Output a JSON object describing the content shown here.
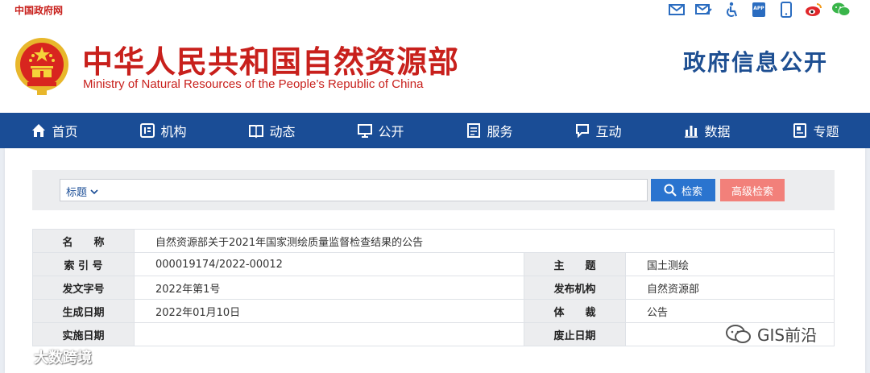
{
  "topbar": {
    "site_link": "中国政府网",
    "icons": [
      "mail-icon",
      "mail-edit-icon",
      "accessibility-icon",
      "app-icon",
      "mobile-icon",
      "weibo-icon",
      "wechat-icon"
    ],
    "app_label": "APP"
  },
  "header": {
    "title_cn": "中华人民共和国自然资源部",
    "title_en": "Ministry of Natural Resources of the People’s Republic of China",
    "gov_info": "政府信息公开"
  },
  "nav": {
    "items": [
      {
        "label": "首页",
        "icon": "home-icon"
      },
      {
        "label": "机构",
        "icon": "org-icon"
      },
      {
        "label": "动态",
        "icon": "book-icon"
      },
      {
        "label": "公开",
        "icon": "monitor-icon"
      },
      {
        "label": "服务",
        "icon": "form-icon"
      },
      {
        "label": "互动",
        "icon": "chat-icon"
      },
      {
        "label": "数据",
        "icon": "bar-chart-icon"
      },
      {
        "label": "专题",
        "icon": "topic-icon"
      }
    ]
  },
  "search": {
    "type_label": "标题",
    "query": "",
    "search_label": "检索",
    "advanced_label": "高级检索"
  },
  "info": {
    "name_label": "名　　称",
    "name_value": "自然资源部关于2021年国家测绘质量监督检查结果的公告",
    "index_label": "索 引 号",
    "index_value": "000019174/2022-00012",
    "topic_label": "主　　题",
    "topic_value": "国土测绘",
    "doc_label": "发文字号",
    "doc_value": "2022年第1号",
    "org_label": "发布机构",
    "org_value": "自然资源部",
    "date_label": "生成日期",
    "date_value": "2022年01月10日",
    "genre_label": "体　　裁",
    "genre_value": "公告",
    "impl_label": "实施日期",
    "impl_value": "",
    "abolish_label": "废止日期",
    "abolish_value": ""
  },
  "watermarks": {
    "left": "大数跨境",
    "right": "GIS前沿"
  },
  "colors": {
    "brand_red": "#c8201c",
    "nav_blue": "#1a4d96",
    "search_blue": "#2a74cf",
    "advanced_pink": "#f2807a"
  }
}
